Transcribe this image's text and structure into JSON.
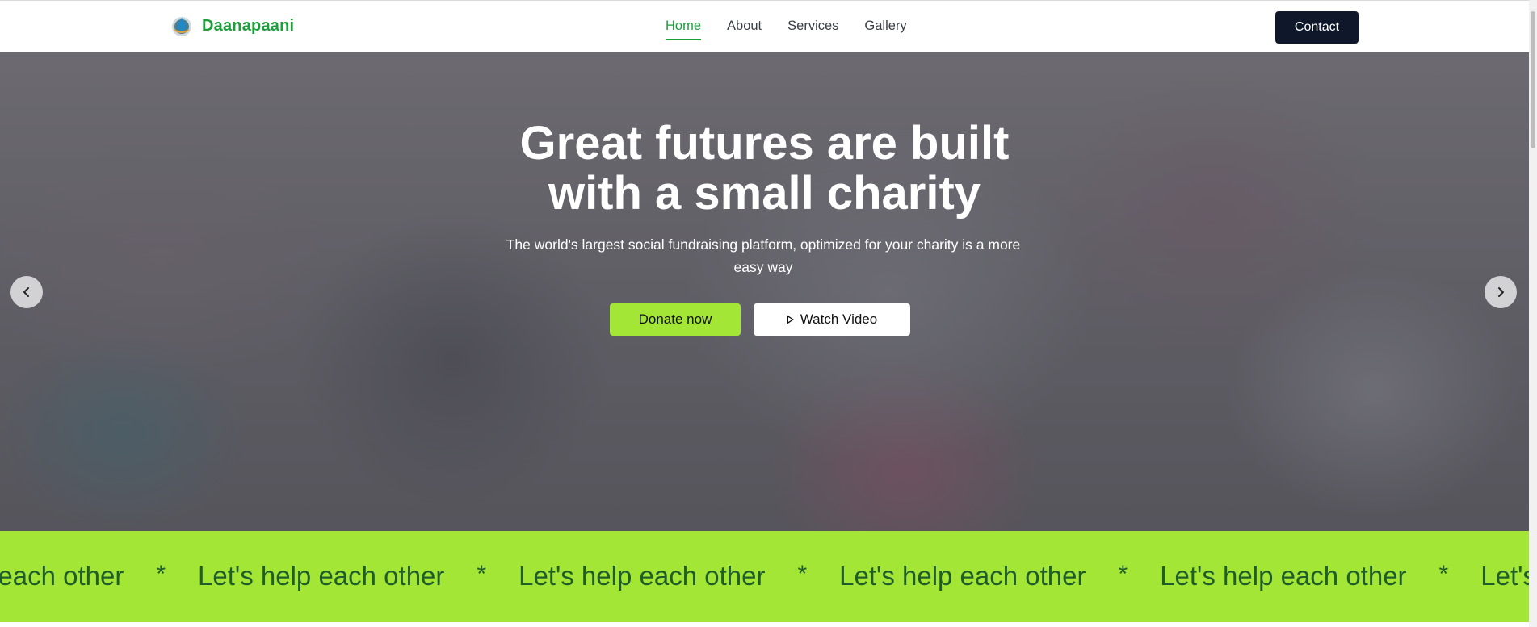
{
  "brand": {
    "name": "Daanapaani",
    "logo_icon": "globe-drop-icon"
  },
  "nav": {
    "items": [
      {
        "label": "Home",
        "active": true
      },
      {
        "label": "About",
        "active": false
      },
      {
        "label": "Services",
        "active": false
      },
      {
        "label": "Gallery",
        "active": false
      }
    ],
    "contact_label": "Contact"
  },
  "hero": {
    "title_line1": "Great futures are built",
    "title_line2": "with a small charity",
    "subtitle": "The world's largest social fundraising platform, optimized for your charity is a more easy way",
    "donate_label": "Donate now",
    "video_label": "Watch Video",
    "prev_icon": "chevron-left-icon",
    "next_icon": "chevron-right-icon"
  },
  "ticker": {
    "items": [
      "Let's help each other",
      "Let's help each other",
      "Let's help each other",
      "Let's help each other",
      "Let's help each other",
      "Let's help each other"
    ],
    "separator": "*"
  },
  "colors": {
    "brand_green": "#1e9e3b",
    "lime": "#a3e635",
    "dark_navy": "#0f172a"
  }
}
